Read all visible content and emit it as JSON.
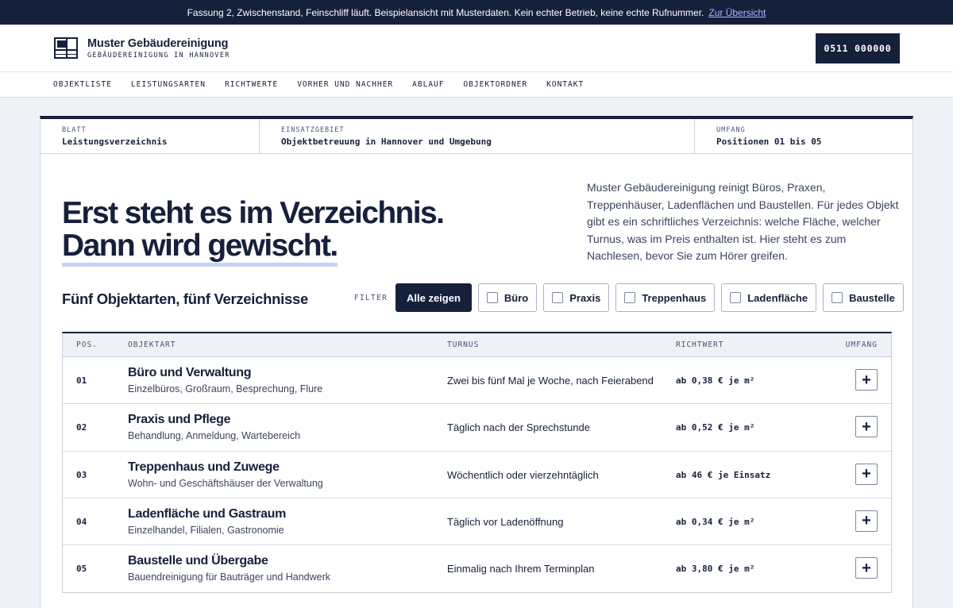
{
  "topbar": {
    "text": "Fassung 2, Zwischenstand, Feinschliff läuft. Beispielansicht mit Musterdaten. Kein echter Betrieb, keine echte Rufnummer.",
    "link": "Zur Übersicht"
  },
  "header": {
    "brand_name": "Muster Gebäudereinigung",
    "brand_sub": "GEBÄUDEREINIGUNG IN HANNOVER",
    "phone": "0511 000000"
  },
  "nav": [
    "OBJEKTLISTE",
    "LEISTUNGSARTEN",
    "RICHTWERTE",
    "VORHER UND NACHHER",
    "ABLAUF",
    "OBJEKTORDNER",
    "KONTAKT"
  ],
  "meta": [
    {
      "key": "BLATT",
      "value": "Leistungsverzeichnis"
    },
    {
      "key": "EINSATZGEBIET",
      "value": "Objektbetreuung in Hannover und Umgebung"
    },
    {
      "key": "UMFANG",
      "value": "Positionen 01 bis 05"
    }
  ],
  "hero": {
    "line1": "Erst steht es im Verzeichnis.",
    "line2": "Dann wird gewischt.",
    "text": "Muster Gebäudereinigung reinigt Büros, Praxen, Treppenhäuser, Ladenflächen und Baustellen. Für jedes Objekt gibt es ein schriftliches Verzeichnis: welche Fläche, welcher Turnus, was im Preis enthalten ist. Hier steht es zum Nachlesen, bevor Sie zum Hörer greifen."
  },
  "section": {
    "title": "Fünf Objektarten, fünf Verzeichnisse",
    "filter_label": "FILTER",
    "filters": [
      {
        "label": "Alle zeigen",
        "active": true
      },
      {
        "label": "Büro",
        "active": false
      },
      {
        "label": "Praxis",
        "active": false
      },
      {
        "label": "Treppenhaus",
        "active": false
      },
      {
        "label": "Ladenfläche",
        "active": false
      },
      {
        "label": "Baustelle",
        "active": false
      }
    ]
  },
  "table": {
    "headers": {
      "pos": "POS.",
      "objektart": "OBJEKTART",
      "turnus": "TURNUS",
      "richtwert": "RICHTWERT",
      "umfang": "UMFANG"
    },
    "rows": [
      {
        "pos": "01",
        "name": "Büro und Verwaltung",
        "sub": "Einzelbüros, Großraum, Besprechung, Flure",
        "turnus": "Zwei bis fünf Mal je Woche, nach Feierabend",
        "price": "ab 0,38 € je m²",
        "expand": "+"
      },
      {
        "pos": "02",
        "name": "Praxis und Pflege",
        "sub": "Behandlung, Anmeldung, Wartebereich",
        "turnus": "Täglich nach der Sprechstunde",
        "price": "ab 0,52 € je m²",
        "expand": "+"
      },
      {
        "pos": "03",
        "name": "Treppenhaus und Zuwege",
        "sub": "Wohn- und Geschäftshäuser der Verwaltung",
        "turnus": "Wöchentlich oder vierzehntäglich",
        "price": "ab 46 € je Einsatz",
        "expand": "+"
      },
      {
        "pos": "04",
        "name": "Ladenfläche und Gastraum",
        "sub": "Einzelhandel, Filialen, Gastronomie",
        "turnus": "Täglich vor Ladenöffnung",
        "price": "ab 0,34 € je m²",
        "expand": "+"
      },
      {
        "pos": "05",
        "name": "Baustelle und Übergabe",
        "sub": "Bauendreinigung für Bauträger und Handwerk",
        "turnus": "Einmalig nach Ihrem Terminplan",
        "price": "ab 3,80 € je m²",
        "expand": "+"
      }
    ]
  },
  "colors": {
    "navy": "#15203b",
    "accent_link": "#a7b6ff",
    "underline": "#c9d2f5",
    "page_bg": "#eef1f6"
  }
}
